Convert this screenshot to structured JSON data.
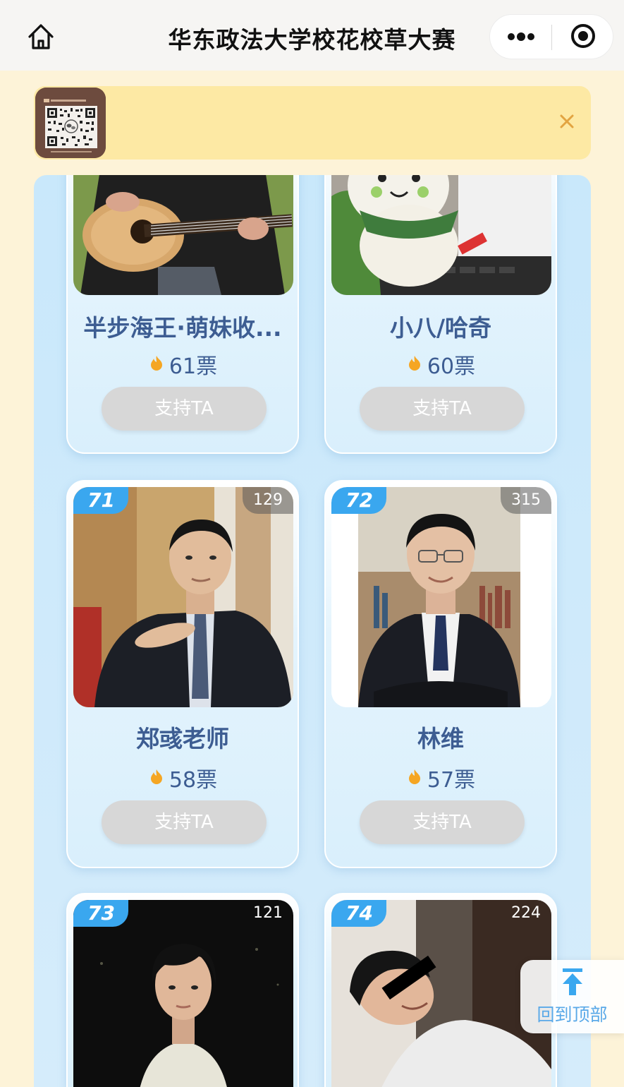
{
  "header": {
    "title": "华东政法大学校花校草大赛"
  },
  "colors": {
    "accent_blue": "#3aa7ef",
    "name_text": "#3d5d92",
    "button_gray": "#d7d7d7",
    "notice_bg": "#fde9a4"
  },
  "support_label": "支持TA",
  "back_to_top_label": "回到顶部",
  "candidates": [
    {
      "name": "半步海王·萌妹收...",
      "votes": "61票"
    },
    {
      "name": "小八/哈奇",
      "votes": "60票"
    },
    {
      "rank": "71",
      "views": "129",
      "name": "郑彧老师",
      "votes": "58票"
    },
    {
      "rank": "72",
      "views": "315",
      "name": "林维",
      "votes": "57票"
    },
    {
      "rank": "73",
      "views": "121"
    },
    {
      "rank": "74",
      "views": "224"
    }
  ]
}
